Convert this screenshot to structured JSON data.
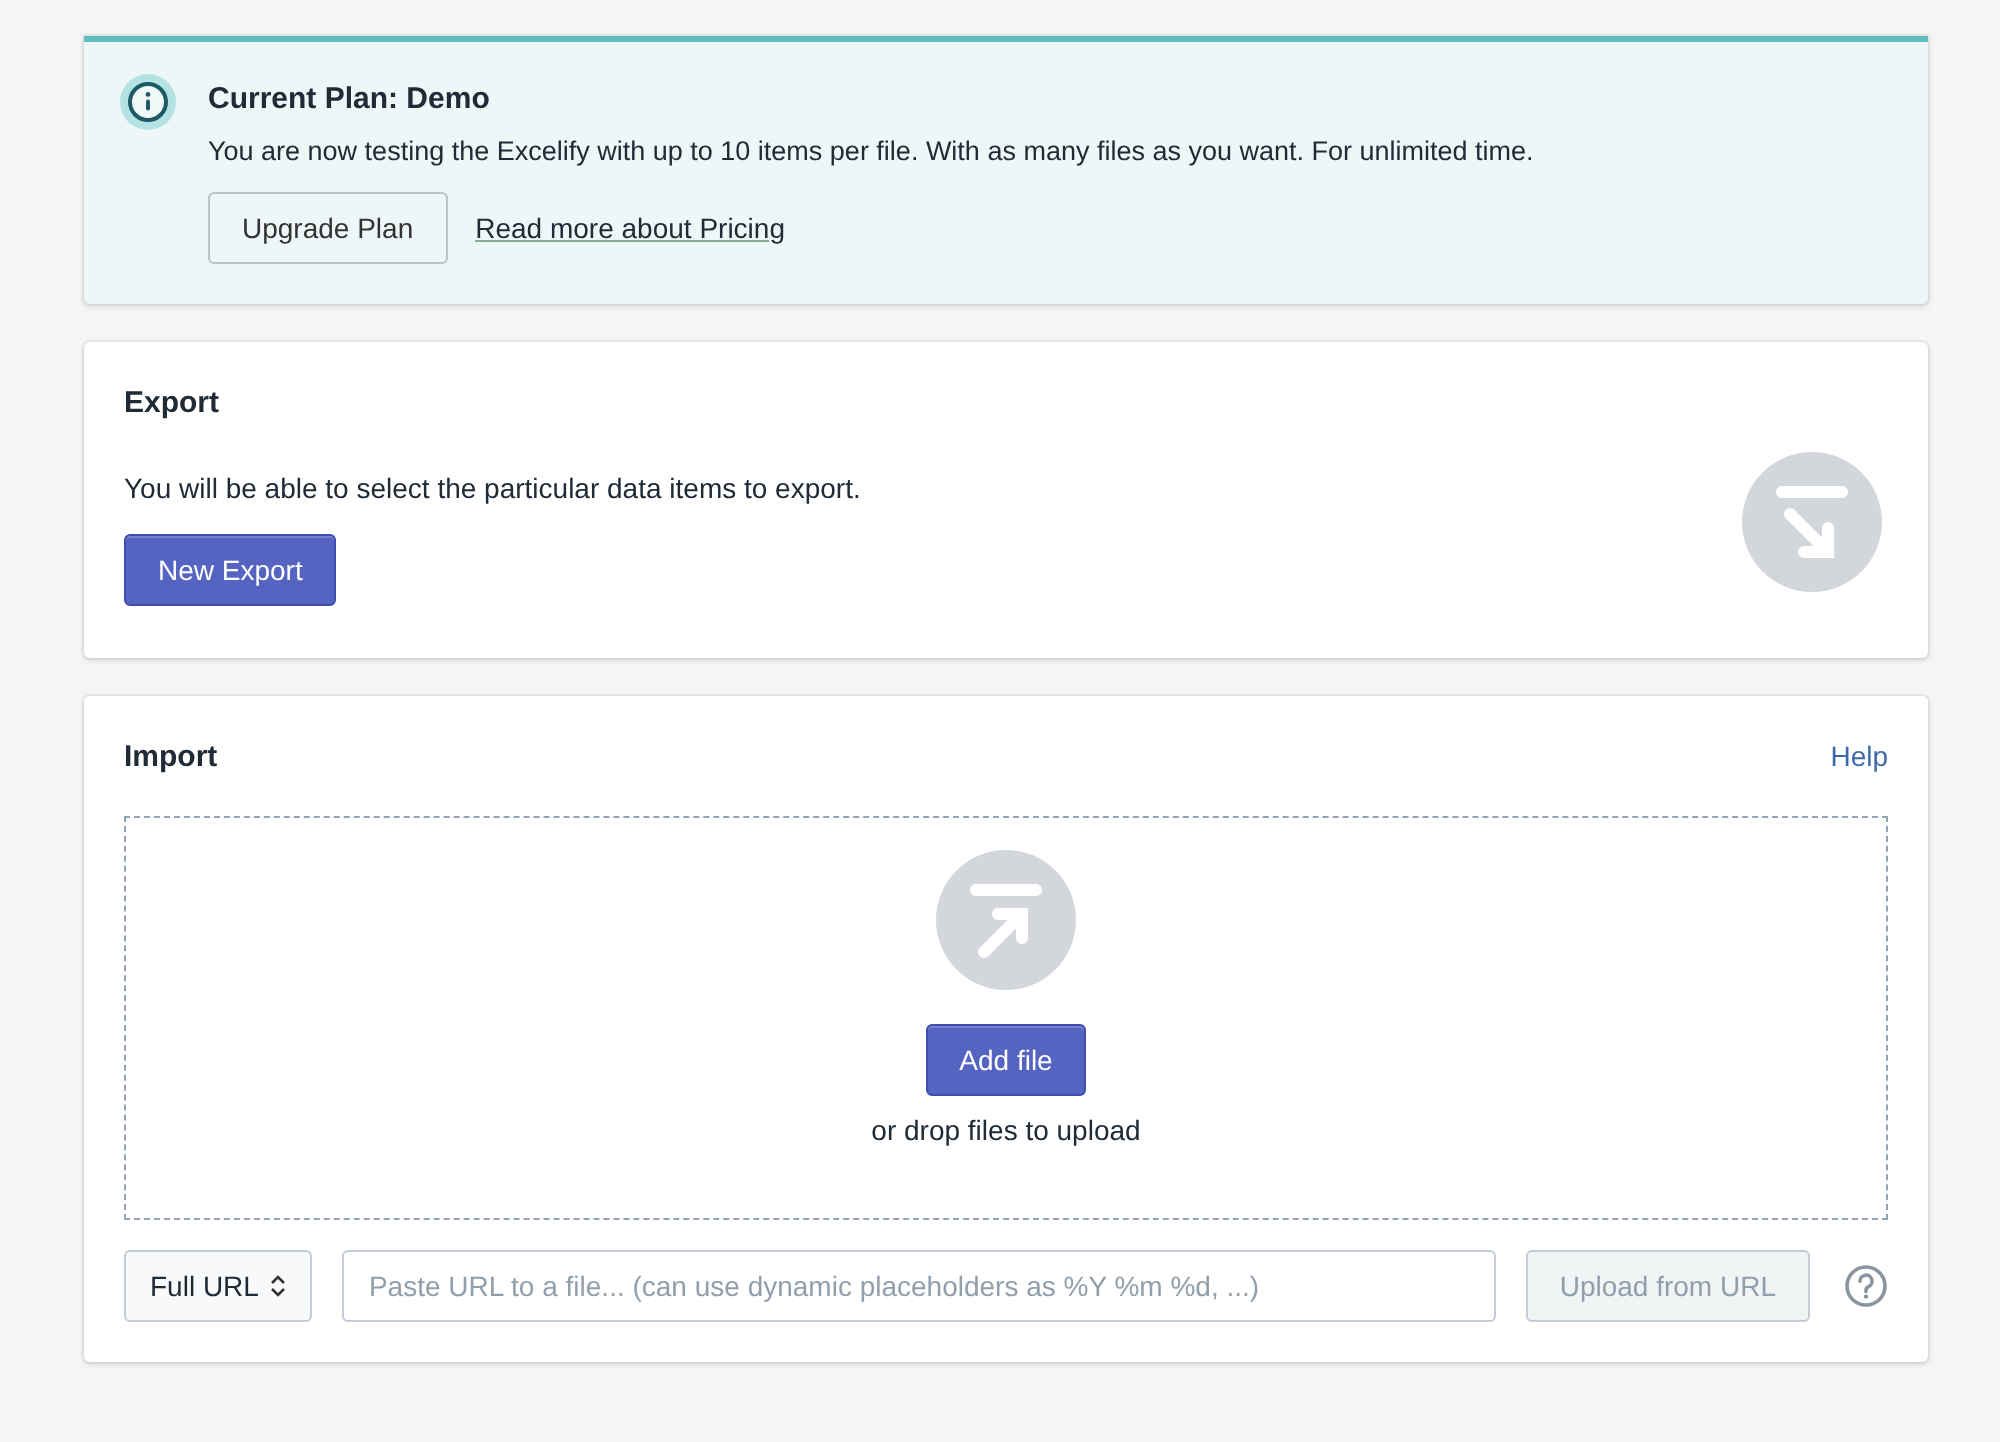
{
  "plan_banner": {
    "title": "Current Plan: Demo",
    "message": "You are now testing the Excelify with up to 10 items per file. With as many files as you want. For unlimited time.",
    "upgrade_button": "Upgrade Plan",
    "pricing_link": "Read more about Pricing"
  },
  "export": {
    "title": "Export",
    "description": "You will be able to select the particular data items to export.",
    "button": "New Export"
  },
  "import": {
    "title": "Import",
    "help_link": "Help",
    "add_button": "Add file",
    "drop_hint": "or drop files to upload",
    "url_type": "Full URL",
    "url_field": {
      "placeholder": "Paste URL to a file... (can use dynamic placeholders as %Y %m %d, ...)"
    },
    "upload_button": {
      "label": "Upload from URL",
      "disabled": true
    }
  }
}
